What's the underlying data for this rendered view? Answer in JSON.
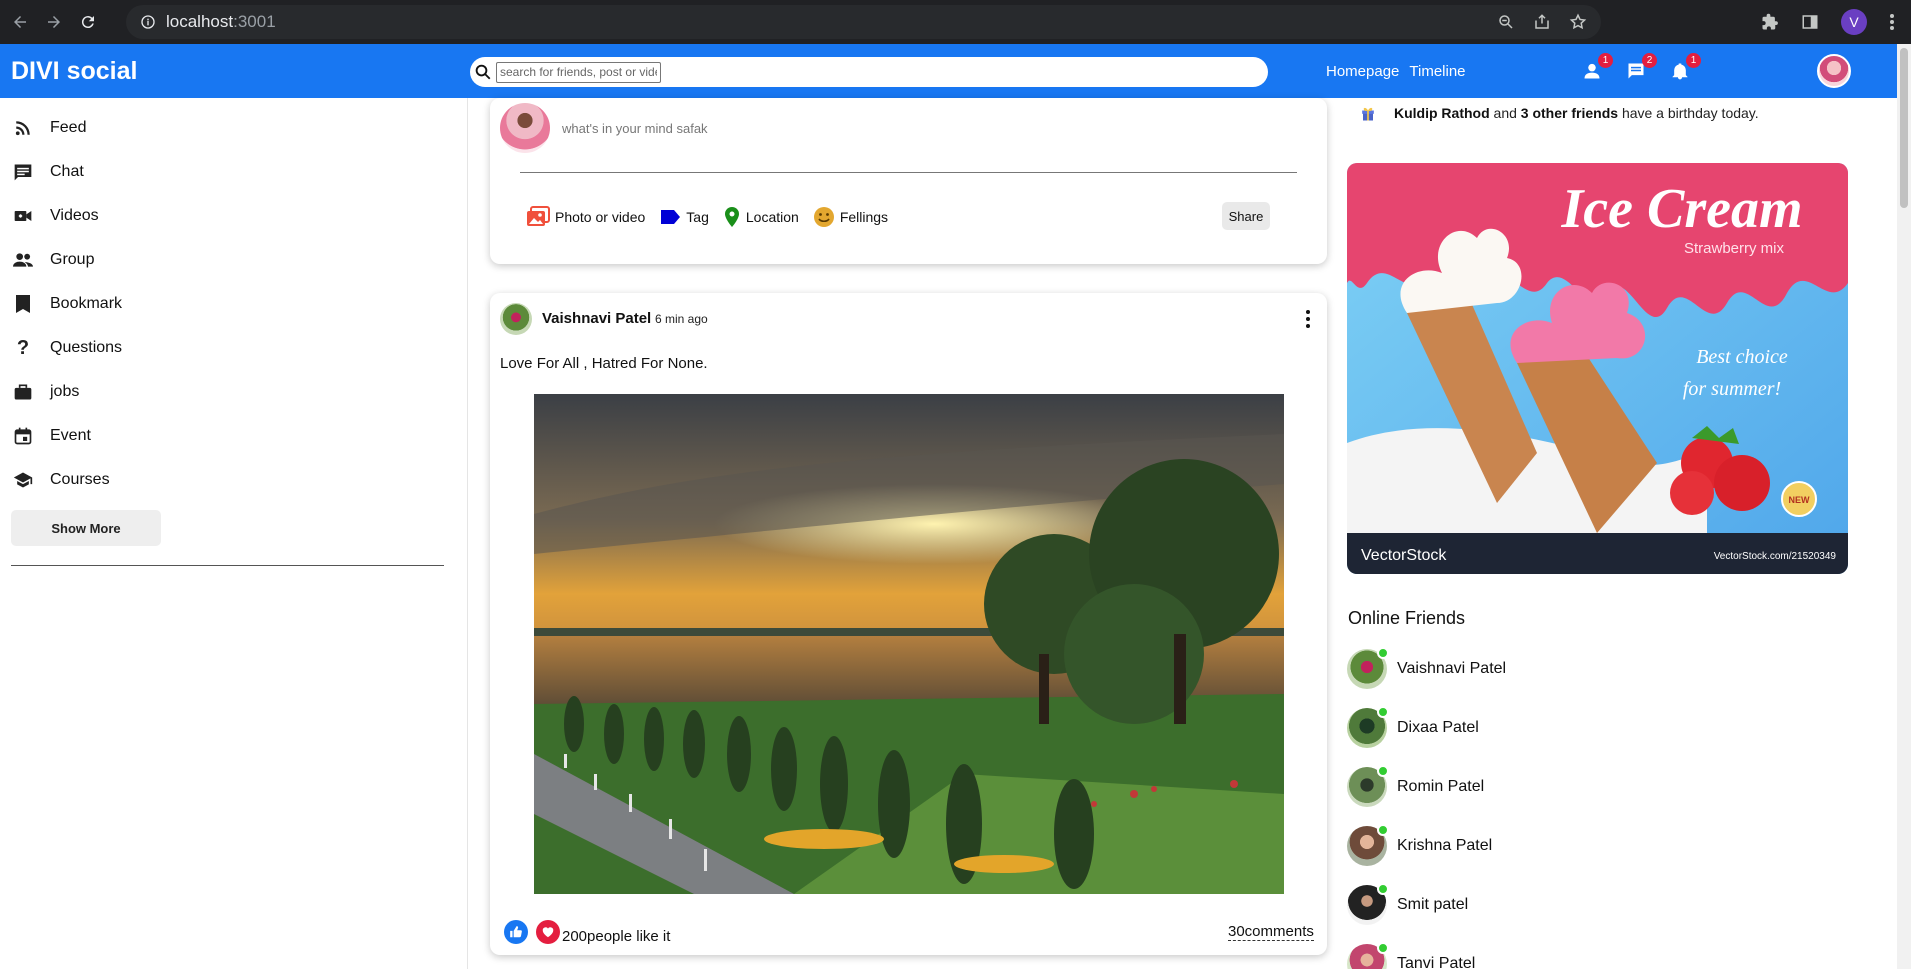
{
  "browser": {
    "url_host": "localhost",
    "url_port": ":3001",
    "profile_initial": "V"
  },
  "topbar": {
    "logo": "DIVI social",
    "search_placeholder": "search for friends, post or video",
    "links": [
      "Homepage",
      "Timeline"
    ],
    "badges": {
      "friends": "1",
      "messages": "2",
      "notifications": "1"
    }
  },
  "sidebar": {
    "items": [
      {
        "label": "Feed",
        "icon": "rss-feed-icon"
      },
      {
        "label": "Chat",
        "icon": "chat-icon"
      },
      {
        "label": "Videos",
        "icon": "video-camera-icon"
      },
      {
        "label": "Group",
        "icon": "group-icon"
      },
      {
        "label": "Bookmark",
        "icon": "bookmark-icon"
      },
      {
        "label": "Questions",
        "icon": "question-mark-icon"
      },
      {
        "label": "jobs",
        "icon": "briefcase-icon"
      },
      {
        "label": "Event",
        "icon": "calendar-icon"
      },
      {
        "label": "Courses",
        "icon": "school-icon"
      }
    ],
    "show_more": "Show More"
  },
  "share": {
    "placeholder": "what's in your mind safak",
    "options": {
      "photo": "Photo or video",
      "tag": "Tag",
      "location": "Location",
      "feelings": "Fellings"
    },
    "share_button": "Share"
  },
  "post": {
    "author": "Vaishnavi Patel",
    "time": "6 min ago",
    "text": "Love For All , Hatred For None.",
    "likes": "200people like it",
    "comments": "30comments"
  },
  "rightbar": {
    "birthday_name": "Kuldip Rathod",
    "birthday_and": "and",
    "birthday_friends": "3 other friends",
    "birthday_rest": "have a birthday today.",
    "ad": {
      "title": "Ice Cream",
      "subtitle": "Strawberry mix",
      "tagline1": "Best choice",
      "tagline2": "for summer!",
      "badge": "NEW",
      "brand": "VectorStock",
      "brand_url": "VectorStock.com/21520349"
    },
    "online_title": "Online Friends",
    "friends": [
      "Vaishnavi Patel",
      "Dixaa Patel",
      "Romin Patel",
      "Krishna Patel",
      "Smit patel",
      "Tanvi Patel"
    ]
  },
  "colors": {
    "brand": "#1877f2",
    "online": "#32cd32",
    "badge": "#e41e3f"
  }
}
